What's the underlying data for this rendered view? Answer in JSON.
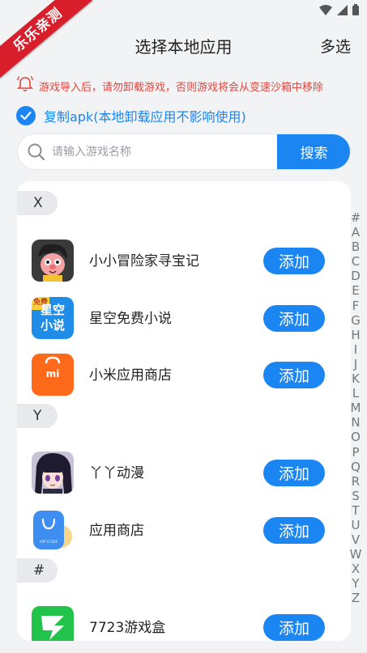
{
  "watermark": "乐乐亲测",
  "header": {
    "title": "选择本地应用",
    "action": "多选"
  },
  "warning": {
    "text": "游戏导入后，请勿卸载游戏，否则游戏将会从变速沙箱中移除",
    "color": "#e0463e"
  },
  "copy_apk": {
    "label": "复制apk(本地卸载应用不影响使用)",
    "checked": true
  },
  "search": {
    "placeholder": "请输入游戏名称",
    "value": "",
    "button_label": "搜索"
  },
  "accent_color": "#1b86f2",
  "sections": [
    {
      "letter": "X",
      "apps": [
        {
          "name": "小小冒险家寻宝记",
          "icon": "cartoon-character-icon",
          "add_label": "添加"
        },
        {
          "name": "星空免费小说",
          "icon": "xingkong-novel-icon",
          "icon_text_top": "星空",
          "icon_text_bottom": "小说",
          "icon_badge": "免费",
          "add_label": "添加"
        },
        {
          "name": "小米应用商店",
          "icon": "mi-store-bag-icon",
          "icon_text": "mi",
          "add_label": "添加"
        }
      ]
    },
    {
      "letter": "Y",
      "apps": [
        {
          "name": "丫丫动漫",
          "icon": "anime-girl-icon",
          "add_label": "添加"
        },
        {
          "name": "应用商店",
          "icon": "app-store-bag-icon",
          "icon_text": "APP STORE",
          "add_label": "添加"
        }
      ]
    },
    {
      "letter": "#",
      "apps": [
        {
          "name": "7723游戏盒",
          "icon": "7723-game-box-icon",
          "add_label": "添加"
        }
      ]
    }
  ],
  "index_letters": [
    "#",
    "A",
    "B",
    "C",
    "D",
    "E",
    "F",
    "G",
    "H",
    "I",
    "J",
    "K",
    "L",
    "M",
    "N",
    "O",
    "P",
    "Q",
    "R",
    "S",
    "T",
    "U",
    "V",
    "W",
    "X",
    "Y",
    "Z"
  ]
}
